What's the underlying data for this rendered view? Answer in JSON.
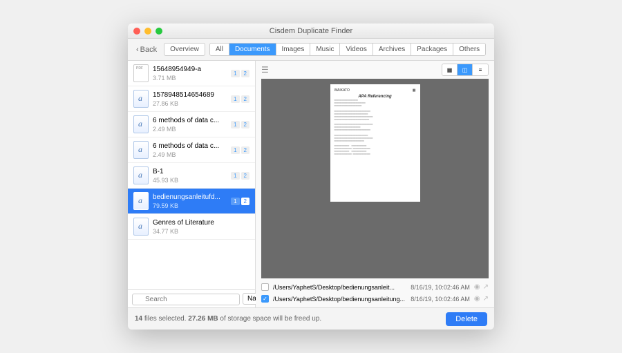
{
  "window": {
    "title": "Cisdem Duplicate Finder"
  },
  "toolbar": {
    "back": "Back",
    "overview": "Overview",
    "tabs": [
      "All",
      "Documents",
      "Images",
      "Music",
      "Videos",
      "Archives",
      "Packages",
      "Others"
    ],
    "active_tab": "Documents"
  },
  "list": {
    "items": [
      {
        "name": "15648954949-a",
        "size": "3.71 MB",
        "icon": "pdf",
        "b1": "1",
        "b2": "2"
      },
      {
        "name": "15789485146546­89",
        "size": "27.86 KB",
        "icon": "doc",
        "b1": "1",
        "b2": "2"
      },
      {
        "name": "6 methods of data c...",
        "size": "2.49 MB",
        "icon": "doc",
        "b1": "1",
        "b2": "2"
      },
      {
        "name": "6 methods of data c...",
        "size": "2.49 MB",
        "icon": "doc",
        "b1": "1",
        "b2": "2"
      },
      {
        "name": "B-1",
        "size": "45.93 KB",
        "icon": "doc",
        "b1": "1",
        "b2": "2"
      },
      {
        "name": "bedienungsanleitufd...",
        "size": "79.59 KB",
        "icon": "doc",
        "b1": "1",
        "b2": "2",
        "selected": true
      },
      {
        "name": "Genres of Literature",
        "size": "34.77 KB",
        "icon": "doc",
        "b1": "",
        "b2": ""
      }
    ],
    "search_placeholder": "Search",
    "sort_label": "Name"
  },
  "preview": {
    "doc_logo": "WAIKATO",
    "doc_title": "APA Referencing"
  },
  "rows": [
    {
      "checked": false,
      "path": "/Users/YaphetS/Desktop/bedienungsanleit...",
      "date": "8/16/19, 10:02:46 AM"
    },
    {
      "checked": true,
      "path": "/Users/YaphetS/Desktop/bedienungsanleitung...",
      "date": "8/16/19, 10:02:46 AM"
    }
  ],
  "footer": {
    "count": "14",
    "files_label": "files selected.",
    "size": "27.26 MB",
    "tail": "of storage space will be freed up.",
    "delete": "Delete"
  }
}
